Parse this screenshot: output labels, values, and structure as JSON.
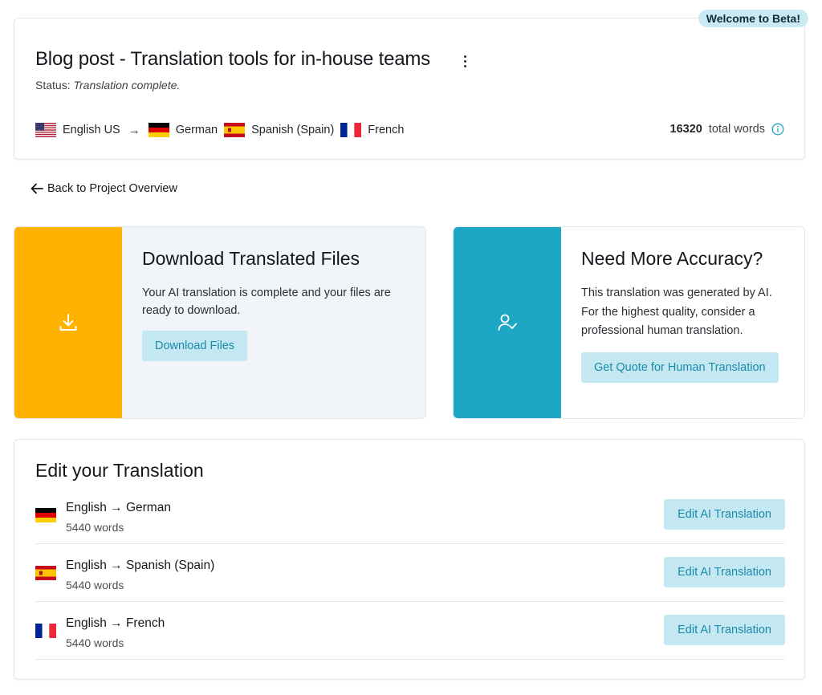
{
  "badge": "Welcome to Beta!",
  "project": {
    "title": "Blog post - Translation tools for in-house teams",
    "status_label": "Status:",
    "status_value": "Translation complete.",
    "source_language": "English US",
    "target_languages": [
      "German",
      "Spanish (Spain)",
      "French"
    ],
    "total_words": "16320",
    "total_words_label": "total words"
  },
  "back_link": "Back to Project Overview",
  "download_card": {
    "title": "Download Translated Files",
    "text": "Your AI translation is complete and your files are ready to download.",
    "button": "Download Files"
  },
  "accuracy_card": {
    "title": "Need More Accuracy?",
    "text": "This translation was generated by AI. For the highest quality, consider a professional human translation.",
    "button": "Get Quote for Human Translation"
  },
  "edit_section": {
    "title": "Edit your Translation",
    "rows": [
      {
        "pair": "English → German",
        "words": "5440 words",
        "button": "Edit AI Translation"
      },
      {
        "pair": "English → Spanish (Spain)",
        "words": "5440 words",
        "button": "Edit AI Translation"
      },
      {
        "pair": "English → French",
        "words": "5440 words",
        "button": "Edit AI Translation"
      }
    ]
  },
  "icons": {
    "flags": [
      "flag-us-icon",
      "flag-germany-icon",
      "flag-spain-icon",
      "flag-france-icon"
    ],
    "other": [
      "more-vertical-icon",
      "arrow-right-icon",
      "info-icon",
      "arrow-left-icon",
      "download-icon",
      "user-check-icon"
    ]
  },
  "colors": {
    "download_accent": "#ffb300",
    "accuracy_accent": "#1ea7c4",
    "button_bg": "#c4e8f1",
    "button_text": "#1a8aaa",
    "badge_bg": "#c9eaf3"
  }
}
